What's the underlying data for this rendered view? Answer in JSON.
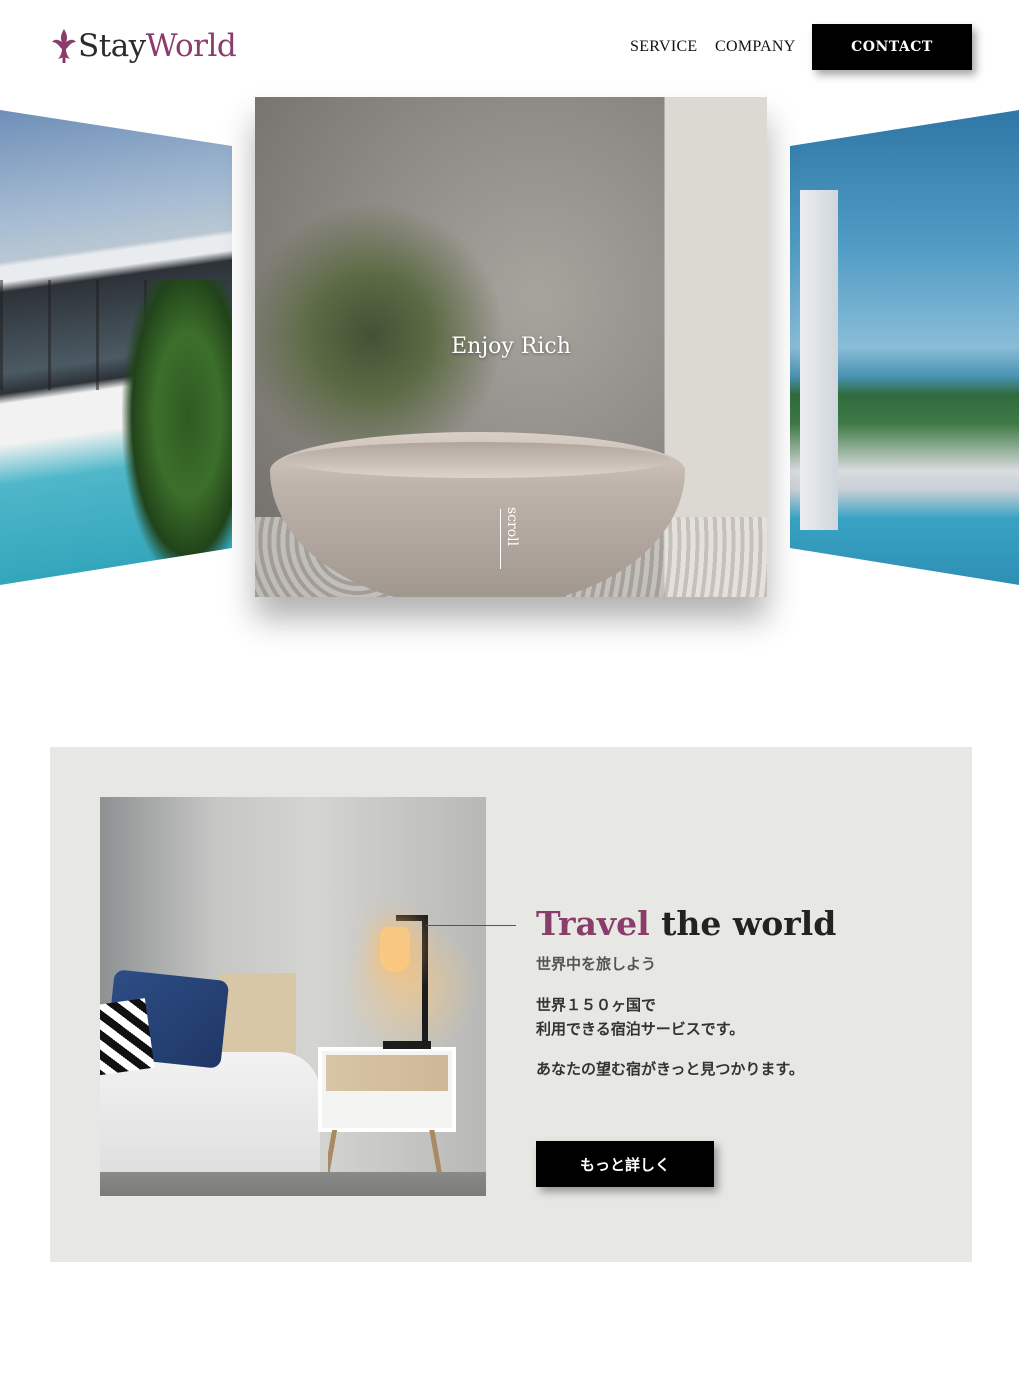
{
  "brand": {
    "name_part1": "Stay",
    "name_part2": "World",
    "accent_color": "#8a3d6b",
    "icon": "fleur-de-lis-icon"
  },
  "nav": {
    "items": [
      {
        "label": "SERVICE"
      },
      {
        "label": "COMPANY"
      }
    ],
    "contact_label": "CONTACT"
  },
  "hero": {
    "title": "Enjoy Rich",
    "scroll_label": "scroll",
    "slides": [
      "pool-villa",
      "bathtub",
      "infinity-pool"
    ]
  },
  "travel": {
    "title_accent": "Travel",
    "title_rest": " the world",
    "subtitle": "世界中を旅しよう",
    "body1": "世界１５０ヶ国で\n利用できる宿泊サービスです。",
    "body2": "あなたの望む宿がきっと見つかります。",
    "button_label": "もっと詳しく",
    "background_color": "#e7e7e3"
  }
}
